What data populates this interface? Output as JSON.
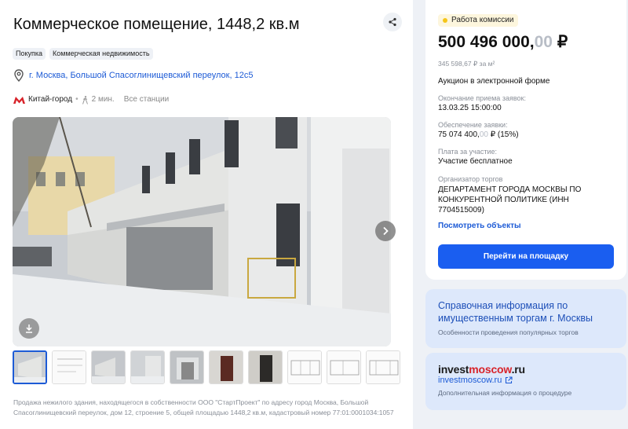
{
  "listing": {
    "title": "Коммерческое помещение, 1448,2 кв.м",
    "tags": [
      "Покупка",
      "Коммерческая недвижимость"
    ],
    "address": "г. Москва, Большой Спасоглинищевский переулок, 12с5",
    "metro": {
      "station": "Китай-город",
      "walk": "2 мин.",
      "all_stations": "Все станции",
      "line_color": "#d8232a"
    },
    "thumbnail_count": 10,
    "description": "Продажа нежилого здания, находящегося в собственности ООО \"СтартПроект\" по адресу город Москва, Большой Спасоглинищевский переулок, дом 12, строение 5, общей площадью 1448,2 кв.м, кадастровый номер 77:01:0001034:1057"
  },
  "auction": {
    "badge": "Работа комиссии",
    "badge_color": "#f5c518",
    "price_main": "500 496 000,",
    "price_kop": "00",
    "price_currency": " ₽",
    "price_per_sqm": "345 598,67 ₽ за м²",
    "format": "Аукцион в электронной форме",
    "deadline_label": "Окончание приема заявок:",
    "deadline_value": "13.03.25 15:00:00",
    "deposit_label": "Обеспечение заявки:",
    "deposit_main": "75 074 400,",
    "deposit_kop": "00",
    "deposit_suffix": " ₽ (15%)",
    "fee_label": "Плата за участие:",
    "fee_value": "Участие бесплатное",
    "organizer_label": "Организатор торгов",
    "organizer_value": "ДЕПАРТАМЕНТ ГОРОДА МОСКВЫ ПО КОНКУРЕНТНОЙ ПОЛИТИКЕ (ИНН 7704515009)",
    "view_objects": "Посмотреть объекты",
    "go_button": "Перейти на площадку",
    "accent": "#1a5ef0"
  },
  "reference": {
    "title": "Справочная информация по имущественным торгам г. Москвы",
    "subtitle": "Особенности проведения популярных торгов"
  },
  "invest": {
    "logo_dark": "invest",
    "logo_red": "moscow",
    "logo_tld": ".ru",
    "link": "investmoscow.ru",
    "subtitle": "Дополнительная информация о процедуре"
  }
}
